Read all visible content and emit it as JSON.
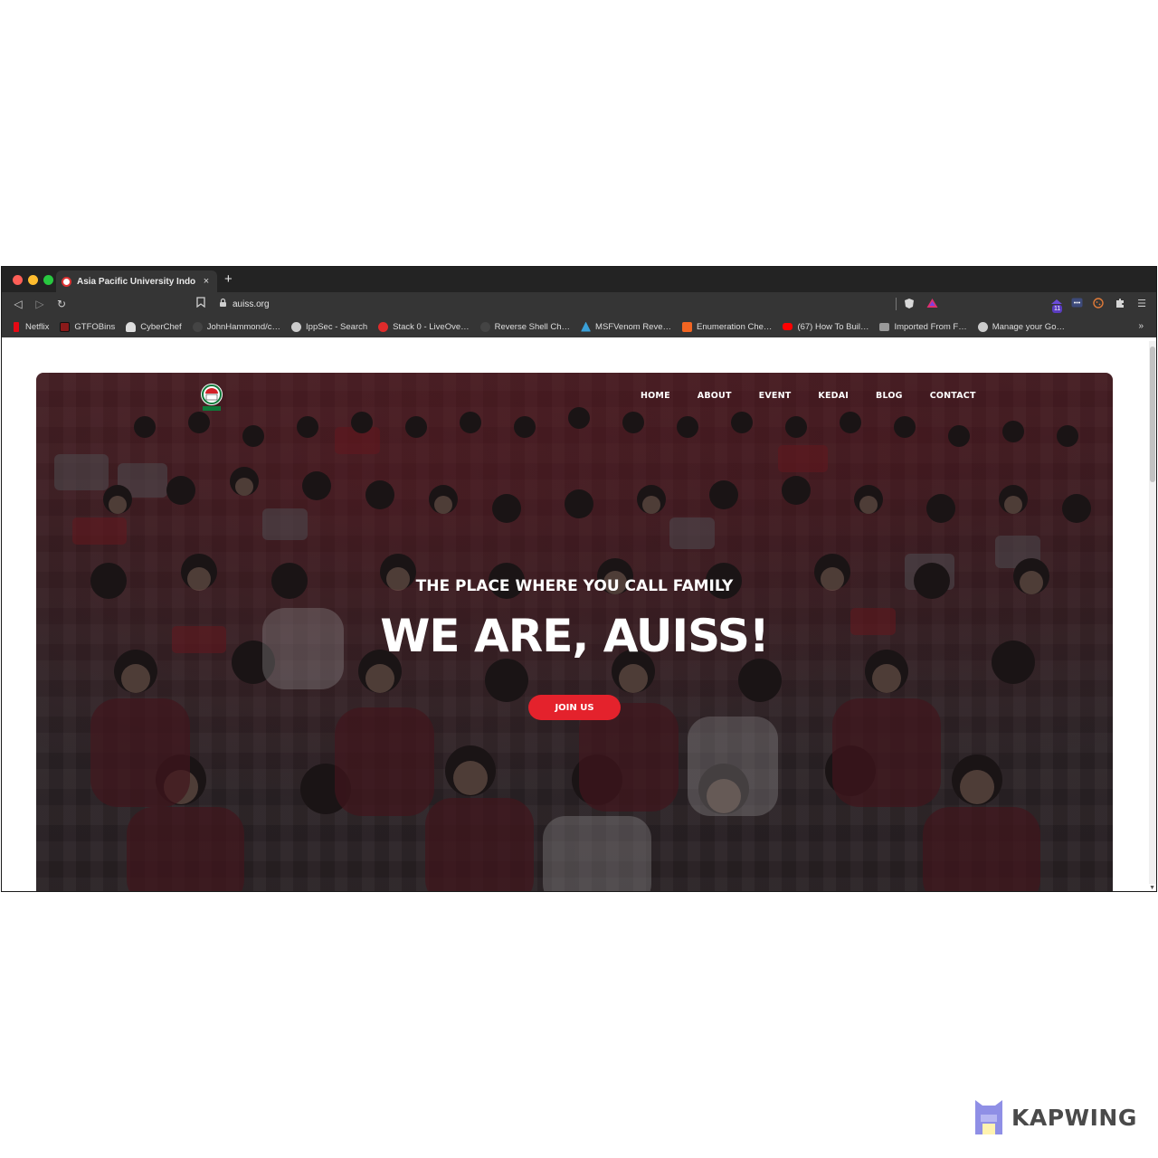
{
  "browser": {
    "tab_title": "Asia Pacific University Indone",
    "tab_close": "×",
    "new_tab": "+",
    "url": "auiss.org",
    "extension_badge": "11",
    "bookmarks": [
      {
        "label": "Netflix",
        "color": "#e50914"
      },
      {
        "label": "GTFOBins",
        "color": "#8b1a1a"
      },
      {
        "label": "CyberChef",
        "color": "#dddddd"
      },
      {
        "label": "JohnHammond/c…",
        "color": "#444444"
      },
      {
        "label": "IppSec - Search",
        "color": "#cccccc"
      },
      {
        "label": "Stack 0 - LiveOve…",
        "color": "#e02b2b"
      },
      {
        "label": "Reverse Shell Ch…",
        "color": "#444444"
      },
      {
        "label": "MSFVenom Reve…",
        "color": "#3aa0d8"
      },
      {
        "label": "Enumeration Che…",
        "color": "#f26522"
      },
      {
        "label": "(67) How To Buil…",
        "color": "#ff0000"
      },
      {
        "label": "Imported From F…",
        "color": "#9a9a9a"
      },
      {
        "label": "Manage your Go…",
        "color": "#cccccc"
      }
    ],
    "more_bookmarks": "»"
  },
  "site": {
    "nav": [
      "HOME",
      "ABOUT",
      "EVENT",
      "KEDAI",
      "BLOG",
      "CONTACT"
    ],
    "tagline": "THE PLACE WHERE YOU CALL FAMILY",
    "headline": "WE ARE, AUISS!",
    "cta": "JOIN US",
    "accent_color": "#e4222c"
  },
  "watermark": {
    "text": "KAPWING"
  }
}
